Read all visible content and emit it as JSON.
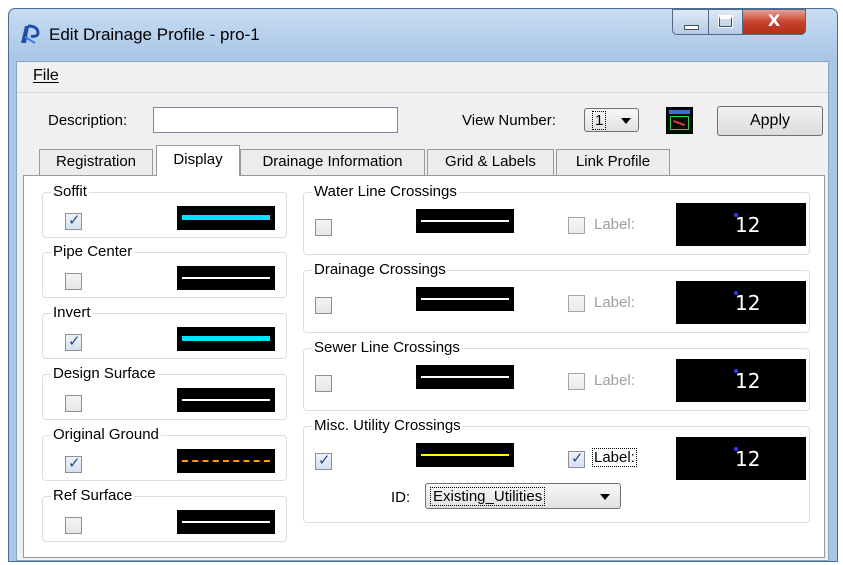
{
  "window": {
    "title": "Edit Drainage Profile - pro-1",
    "icon": "drainage-profile-app-icon"
  },
  "caption_buttons": {
    "minimize_icon": "minimize-icon",
    "maximize_icon": "maximize-icon",
    "close_icon": "close-icon"
  },
  "menu": {
    "file": "File"
  },
  "toolbar": {
    "description_label": "Description:",
    "description_value": "",
    "view_number_label": "View Number:",
    "view_number_value": "1",
    "view_icon": "view-window-icon",
    "apply_label": "Apply"
  },
  "tabs": [
    {
      "label": "Registration",
      "selected": false
    },
    {
      "label": "Display",
      "selected": true
    },
    {
      "label": "Drainage Information",
      "selected": false
    },
    {
      "label": "Grid & Labels",
      "selected": false
    },
    {
      "label": "Link Profile",
      "selected": false
    }
  ],
  "left_groups": [
    {
      "title": "Soffit",
      "checked": true,
      "line_color": "#00e5ff",
      "line_style": "solid-thick"
    },
    {
      "title": "Pipe Center",
      "checked": false,
      "line_color": "#ffffff",
      "line_style": "solid-thin"
    },
    {
      "title": "Invert",
      "checked": true,
      "line_color": "#00e5ff",
      "line_style": "solid-thick"
    },
    {
      "title": "Design Surface",
      "checked": false,
      "line_color": "#ffffff",
      "line_style": "solid-thin"
    },
    {
      "title": "Original Ground",
      "checked": true,
      "line_color": "#ff9a00",
      "line_style": "dashed"
    },
    {
      "title": "Ref Surface",
      "checked": false,
      "line_color": "#ffffff",
      "line_style": "solid-thin"
    }
  ],
  "right_groups": [
    {
      "title": "Water Line Crossings",
      "checked": false,
      "line_color": "#ffffff",
      "label_text": "Label:",
      "label_checked": false,
      "label_enabled": false,
      "preview_value": "12"
    },
    {
      "title": "Drainage Crossings",
      "checked": false,
      "line_color": "#ffffff",
      "label_text": "Label:",
      "label_checked": false,
      "label_enabled": false,
      "preview_value": "12"
    },
    {
      "title": "Sewer Line Crossings",
      "checked": false,
      "line_color": "#ffffff",
      "label_text": "Label:",
      "label_checked": false,
      "label_enabled": false,
      "preview_value": "12"
    },
    {
      "title": "Misc. Utility Crossings",
      "checked": true,
      "line_color": "#ffff00",
      "label_text": "Label:",
      "label_checked": true,
      "label_enabled": true,
      "preview_value": "12"
    }
  ],
  "misc_id": {
    "label": "ID:",
    "value": "Existing_Utilities"
  }
}
